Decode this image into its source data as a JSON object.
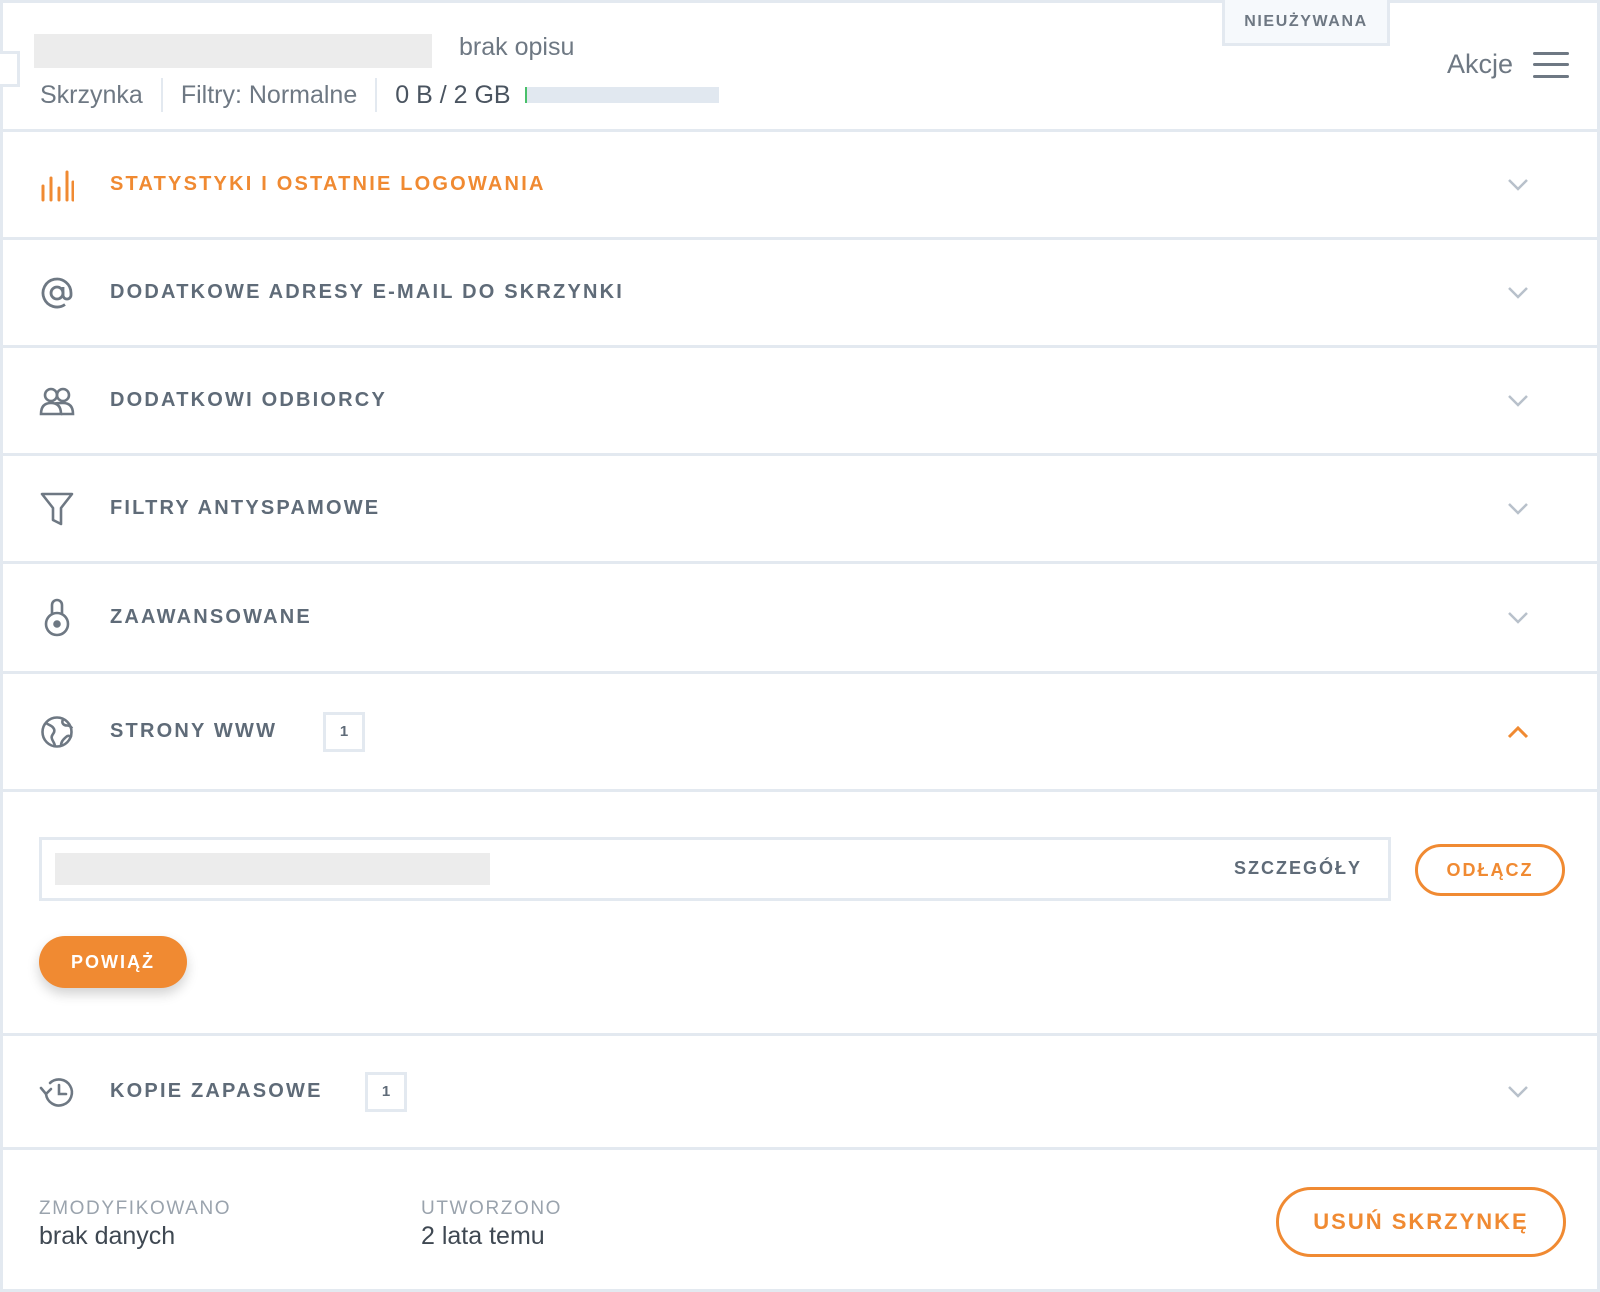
{
  "header": {
    "description": "brak opisu",
    "type": "Skrzynka",
    "filters": "Filtry: Normalne",
    "quota": "0 B / 2 GB",
    "quota_used_fraction": 0.0,
    "status": "NIEUŻYWANA",
    "actions_label": "Akcje"
  },
  "sections": [
    {
      "label": "STATYSTYKI I OSTATNIE LOGOWANIA",
      "icon": "bar-chart-icon",
      "active": true
    },
    {
      "label": "DODATKOWE ADRESY E-MAIL DO SKRZYNKI",
      "icon": "at-sign-icon"
    },
    {
      "label": "DODATKOWI ODBIORCY",
      "icon": "users-icon"
    },
    {
      "label": "FILTRY ANTYSPAMOWE",
      "icon": "funnel-icon"
    },
    {
      "label": "ZAAWANSOWANE",
      "icon": "advanced-icon"
    },
    {
      "label": "STRONY WWW",
      "icon": "globe-icon",
      "count": "1",
      "expanded": true
    },
    {
      "label": "KOPIE ZAPASOWE",
      "icon": "history-icon",
      "count": "1"
    }
  ],
  "websites": {
    "details_label": "SZCZEGÓŁY",
    "disconnect_label": "ODŁĄCZ",
    "link_label": "POWIĄŻ"
  },
  "footer": {
    "modified_label": "ZMODYFIKOWANO",
    "modified_value": "brak danych",
    "created_label": "UTWORZONO",
    "created_value": "2 lata temu",
    "delete_label": "USUŃ SKRZYNKĘ"
  },
  "colors": {
    "accent": "#f08a32",
    "border": "#e3e9f0",
    "text": "#5f6b78",
    "quota_fill": "#49c06a"
  }
}
